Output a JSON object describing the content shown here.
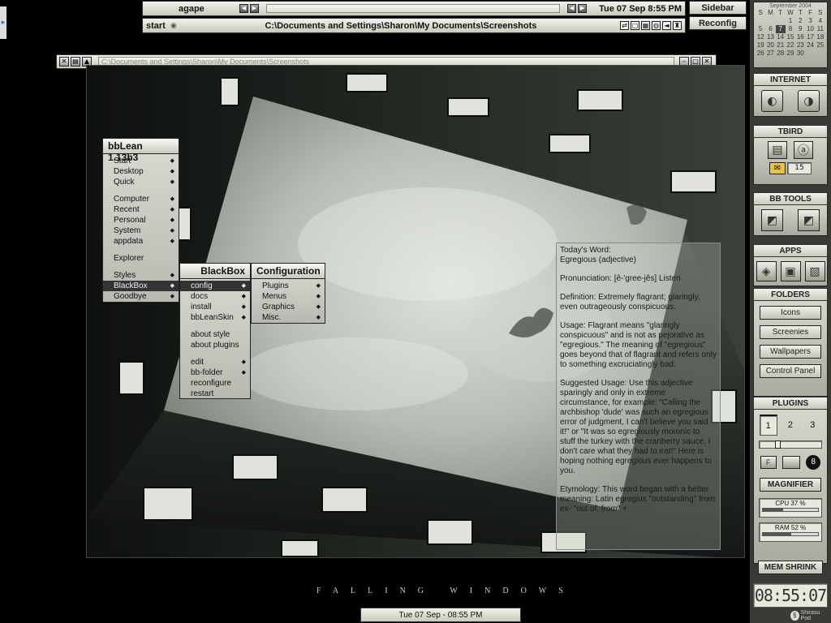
{
  "toolbar": {
    "workspace_label": "agape",
    "clock": "Tue 07 Sep 8:55 PM",
    "start_label": "start",
    "window_title": "C:\\Documents and Settings\\Sharon\\My Documents\\Screenshots",
    "tray_icons": [
      "network-icon",
      "monitor-icon",
      "grid-icon",
      "globe-icon",
      "speaker-icon",
      "tray-app-icon"
    ]
  },
  "side_buttons": {
    "sidebar": "Sidebar",
    "reconfig": "Reconfig"
  },
  "window": {
    "path": "C:\\Documents and Settings\\Sharon\\My Documents\\Screenshots"
  },
  "menus": {
    "main": {
      "title": "bbLean 1.13b3",
      "items": [
        "Start",
        "Desktop",
        "Quick",
        "Computer",
        "Recent",
        "Personal",
        "System",
        "appdata",
        "Explorer",
        "Styles",
        "BlackBox",
        "Goodbye"
      ]
    },
    "blackbox": {
      "title": "BlackBox",
      "items": [
        "config",
        "docs",
        "install",
        "bbLeanSkin",
        "about style",
        "about plugins",
        "edit",
        "bb-folder",
        "reconfigure",
        "restart"
      ]
    },
    "configuration": {
      "title": "Configuration",
      "items": [
        "Plugins",
        "Menus",
        "Graphics",
        "Misc."
      ]
    }
  },
  "word_of_day": {
    "heading": "Today's Word:\nEgregious (adjective)",
    "pronunciation": "Pronunciation: [ê-'gree-jês] Listen",
    "definition": "Definition: Extremely flagrant; glaringly, even outrageously conspicuous.",
    "usage": "Usage: Flagrant means \"glaringly conspicuous\" and is not as pejorative as \"egregious.\" The meaning of \"egregious\" goes beyond that of flagrant and refers only to something excruciatingly bad.",
    "suggested": "Suggested Usage: Use this adjective sparingly and only in extreme circumstance, for example: \"Calling the archbishop 'dude' was such an egregious error of judgment, I can't believe you said it!\" or \"It was so egregiously moronic to stuff the turkey with the cranberry sauce, I don't care what they had to eat!\" Here is hoping nothing egregious ever happens to you.",
    "etymology": "Etymology: This word began with a better meaning: Latin egregius \"outstanding\" from ex- \"out of, from\" +"
  },
  "caption": "FALLING WINDOWS",
  "bottom_clock": "Tue 07 Sep - 08:55 PM",
  "slit": {
    "calendar": {
      "month": "September 2004",
      "weekdays": [
        "S",
        "M",
        "T",
        "W",
        "T",
        "F",
        "S"
      ],
      "days": [
        "",
        "",
        "",
        "1",
        "2",
        "3",
        "4",
        "5",
        "6",
        "7",
        "8",
        "9",
        "10",
        "11",
        "12",
        "13",
        "14",
        "15",
        "16",
        "17",
        "18",
        "19",
        "20",
        "21",
        "22",
        "23",
        "24",
        "25",
        "26",
        "27",
        "28",
        "29",
        "30",
        "",
        ""
      ],
      "today": "7"
    },
    "internet": "INTERNET",
    "tbird": "TBIRD",
    "mail_count": "15",
    "bb_tools": "BB TOOLS",
    "apps": "APPS",
    "folders": {
      "title": "FOLDERS",
      "items": [
        "Icons",
        "Screenies",
        "Wallpapers",
        "Control Panel"
      ]
    },
    "plugins": {
      "title": "PLUGINS",
      "workspaces": [
        "1",
        "2",
        "3"
      ],
      "slider_fraction": 0.25,
      "small_buttons": [
        "F",
        "",
        "8"
      ]
    },
    "magnifier": "MAGNIFIER",
    "cpu": {
      "label": "CPU 37 %",
      "fraction": 0.37
    },
    "ram": {
      "label": "RAM 52 %",
      "fraction": 0.52
    },
    "mem_shrink": "MEM SHRINK",
    "clock": "08:55:07",
    "brand": "Shirasu Pod"
  }
}
